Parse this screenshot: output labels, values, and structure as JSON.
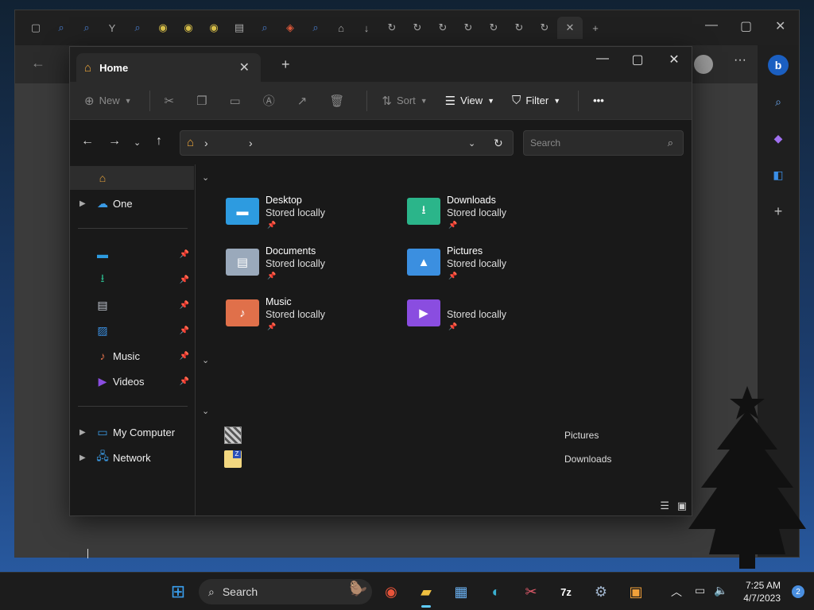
{
  "explorer": {
    "tab_title": "Home",
    "commands": {
      "new": "New",
      "sort": "Sort",
      "view": "View",
      "filter": "Filter",
      "more": "•••"
    },
    "search_placeholder": "Search"
  },
  "nav": {
    "onedrive": "One",
    "music": "Music",
    "videos": "Videos",
    "computer": "My Computer",
    "network": "Network"
  },
  "quick_access": [
    {
      "name": "Desktop",
      "status": "Stored locally",
      "color": "#2d9be0"
    },
    {
      "name": "Downloads",
      "status": "Stored locally",
      "color": "#2bb58a"
    },
    {
      "name": "Documents",
      "status": "Stored locally",
      "color": "#9aa9bb"
    },
    {
      "name": "Pictures",
      "status": "Stored locally",
      "color": "#3b8fe0"
    },
    {
      "name": "Music",
      "status": "Stored locally",
      "color": "#e0704a"
    },
    {
      "name": "",
      "status": "Stored locally",
      "color": "#8a4de0"
    }
  ],
  "recent": [
    {
      "location": "Pictures"
    },
    {
      "location": "Downloads"
    }
  ],
  "taskbar": {
    "search_label": "Search",
    "time": "7:25 AM",
    "date": "4/7/2023",
    "notifications": "2"
  }
}
